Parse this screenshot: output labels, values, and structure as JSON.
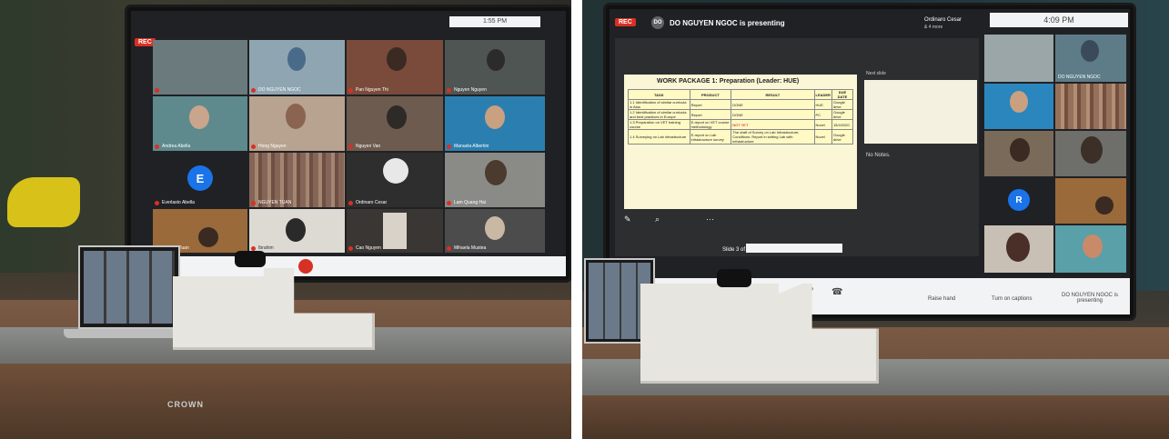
{
  "left_photo": {
    "rec_label": "REC",
    "clock": "1:55 PM",
    "participant_initial": "E",
    "brand": "CROWN",
    "participants": [
      {
        "name": ""
      },
      {
        "name": "DO NGUYEN NGOC"
      },
      {
        "name": "Pan Nguyen Thi"
      },
      {
        "name": "Nguyen Nguyen"
      },
      {
        "name": "Andrea Abella"
      },
      {
        "name": "Hong Nguyen"
      },
      {
        "name": "Nguyen Van"
      },
      {
        "name": "Manuela Albertini"
      },
      {
        "name": "Everlasto Abella"
      },
      {
        "name": "NGUYEN TUAN"
      },
      {
        "name": "Ordinaro Cesar"
      },
      {
        "name": "Lam Quang Hai"
      },
      {
        "name": "Nguyen Tuan"
      },
      {
        "name": "Ibrahim"
      },
      {
        "name": "Cao Nguyen"
      },
      {
        "name": "Mihaela Mustea"
      }
    ]
  },
  "right_photo": {
    "rec_label": "REC",
    "presenter_initials": "DO",
    "presenting_text": "DO NGUYEN NGOC is presenting",
    "top_right_label": "Ordinaro Cesar",
    "top_right_sub": "& 4 more",
    "clock": "4:09 PM",
    "self_tile_name": "DO NGUYEN NGOC",
    "participant_initial": "R",
    "next_slide_label": "Next slide",
    "notes_label": "No Notes.",
    "slide_counter": "Slide 3 of",
    "slide_title": "WORK PACKAGE 1: Preparation (Leader: HUE)",
    "table_headers": [
      "TASK",
      "PRODUCT",
      "RESULT",
      "LEADER",
      "DUE DATE"
    ],
    "table_rows": [
      [
        "1.1 Identification of similar curricula in Asia",
        "Report",
        "DONE",
        "HUE",
        "Google drive"
      ],
      [
        "1.2 Identification of similar curricula and best practices in Europe",
        "Report",
        "DONE",
        "PC",
        "Google drive"
      ],
      [
        "1.3 Preparation on VET training course",
        "E-report on VET course methodology",
        "NOT YET",
        "Novel",
        "15/4/2020"
      ],
      [
        "1.4 Surveying on Lab infrastructure",
        "E-report on Lab infrastructure survey",
        "The draft of Survey on Lab Infrastructure; Conditions: Report in setting Lab with infrastructure",
        "Novel",
        "Google drive"
      ]
    ],
    "controls": {
      "raise_hand": "Raise hand",
      "captions": "Turn on captions",
      "presenting": "DO NGUYEN NGOC is presenting"
    }
  },
  "colors": {
    "rec_red": "#d93025",
    "meet_dark": "#202124",
    "tile_bg": "#3c4043",
    "avatar_blue": "#1a73e8"
  }
}
